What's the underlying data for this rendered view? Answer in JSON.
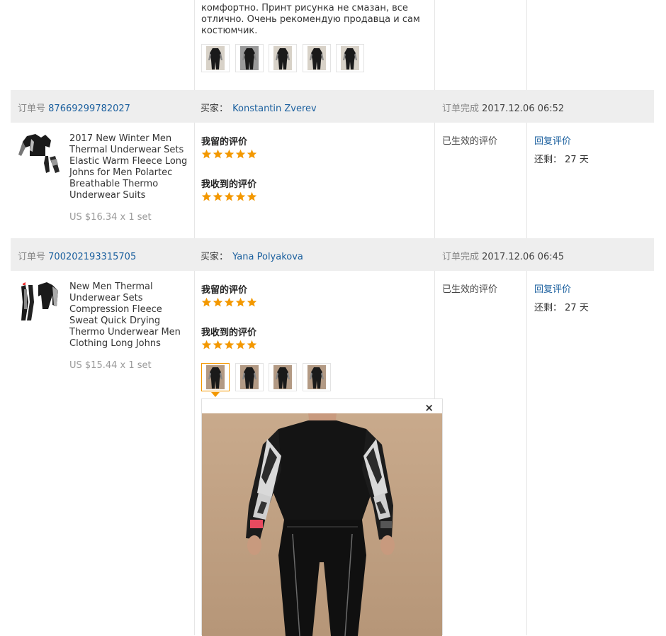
{
  "top_review": {
    "text_line1": "комфортно. Принт рисунка не смазан, все",
    "text_line2": "отлично. Очень рекомендую продавца и сам",
    "text_line3": "костюмчик.",
    "thumb_count": 5
  },
  "orders": [
    {
      "order_label": "订单号",
      "order_no": "87669299782027",
      "buyer_label": "买家：",
      "buyer": "Konstantin Zverev",
      "complete_label": "订单完成",
      "complete_time": "2017.12.06 06:52",
      "product_title": "2017 New Winter Men Thermal Underwear Sets Elastic Warm Fleece Long Johns for Men Polartec Breathable Thermo Underwear Suits",
      "price": "US $16.34 x 1 set",
      "my_review_label": "我留的评价",
      "my_stars": 5,
      "received_label": "我收到的评价",
      "received_stars": 5,
      "status": "已生效的评价",
      "reply": "回复评价",
      "remain_label": "还剩：",
      "remain_days": "27 天"
    },
    {
      "order_label": "订单号",
      "order_no": "700202193315705",
      "buyer_label": "买家：",
      "buyer": "Yana Polyakova",
      "complete_label": "订单完成",
      "complete_time": "2017.12.06 06:45",
      "product_title": "New Men Thermal Underwear Sets Compression Fleece Sweat Quick Drying Thermo Underwear Men Clothing Long Johns",
      "price": "US $15.44 x 1 set",
      "my_review_label": "我留的评价",
      "my_stars": 5,
      "received_label": "我收到的评价",
      "received_stars": 5,
      "status": "已生效的评价",
      "reply": "回复评价",
      "remain_label": "还剩：",
      "remain_days": "27 天",
      "thumb_count": 4,
      "selected_thumb": 1
    }
  ],
  "preview": {
    "close_glyph": "×"
  },
  "colors": {
    "link_blue": "#1a5f9e",
    "star_orange": "#f39800",
    "header_bg": "#eeeeee"
  }
}
